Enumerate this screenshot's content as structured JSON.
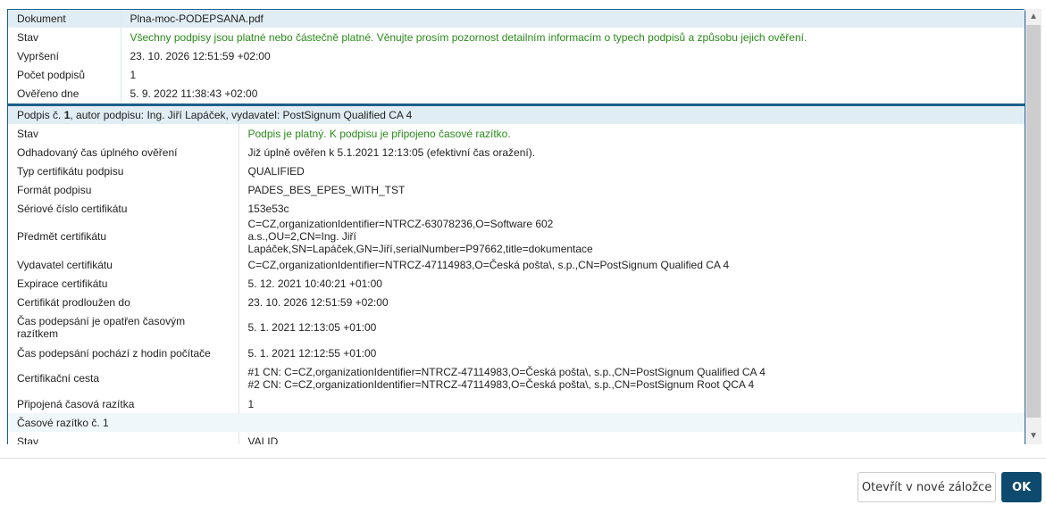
{
  "document": {
    "rows": [
      {
        "label": "Dokument",
        "value": "Plna-moc-PODEPSANA.pdf"
      },
      {
        "label": "Stav",
        "value": "Všechny podpisy jsou platné nebo částečně platné. Věnujte prosím pozornost detailním informacím o typech podpisů a způsobu jejich ověření."
      },
      {
        "label": "Vypršení",
        "value": "23. 10. 2026 12:51:59 +02:00"
      },
      {
        "label": "Počet podpisů",
        "value": "1"
      },
      {
        "label": "Ověřeno dne",
        "value": "5. 9. 2022 11:38:43 +02:00"
      }
    ]
  },
  "signature": {
    "header_prefix": "Podpis č. ",
    "header_number": "1",
    "header_rest": ", autor podpisu: Ing. Jiří Lapáček, vydavatel: PostSignum Qualified CA 4",
    "rows": [
      {
        "label": "Stav",
        "value": "Podpis je platný. K podpisu je připojeno časové razítko."
      },
      {
        "label": "Odhadovaný čas úplného ověření",
        "value": "Již úplně ověřen k 5.1.2021 12:13:05 (efektivní čas oražení)."
      },
      {
        "label": "Typ certifikátu podpisu",
        "value": "QUALIFIED"
      },
      {
        "label": "Formát podpisu",
        "value": "PADES_BES_EPES_WITH_TST"
      },
      {
        "label": "Sériové číslo certifikátu",
        "value": "153e53c"
      },
      {
        "label": "Předmět certifikátu",
        "value": "C=CZ,organizationIdentifier=NTRCZ-63078236,O=Software 602 a.s.,OU=2,CN=Ing. Jiří Lapáček,SN=Lapáček,GN=Jiří,serialNumber=P97662,title=dokumentace"
      },
      {
        "label": "Vydavatel certifikátu",
        "value": "C=CZ,organizationIdentifier=NTRCZ-47114983,O=Česká pošta\\, s.p.,CN=PostSignum Qualified CA 4"
      },
      {
        "label": "Expirace certifikátu",
        "value": "5. 12. 2021 10:40:21 +01:00"
      },
      {
        "label": "Certifikát prodloužen do",
        "value": "23. 10. 2026 12:51:59 +02:00"
      },
      {
        "label": "Čas podepsání je opatřen časovým razítkem",
        "value": "5. 1. 2021 12:13:05 +01:00"
      },
      {
        "label": "Čas podepsání pochází z hodin počítače",
        "value": "5. 1. 2021 12:12:55 +01:00"
      },
      {
        "label": "Certifikační cesta",
        "value": "#1 CN: C=CZ,organizationIdentifier=NTRCZ-47114983,O=Česká pošta\\, s.p.,CN=PostSignum Qualified CA 4",
        "value2": "#2 CN: C=CZ,organizationIdentifier=NTRCZ-47114983,O=Česká pošta\\, s.p.,CN=PostSignum Root QCA 4"
      },
      {
        "label": "Připojená časová razítka",
        "value": "1"
      }
    ],
    "timestamp_header": "Časové razítko č. 1",
    "timestamp_rows": [
      {
        "label": "Stav",
        "value": "VALID"
      }
    ]
  },
  "buttons": {
    "open": "Otevřít v nové záložce",
    "ok": "OK"
  },
  "colors": {
    "accent": "#1a5e8a",
    "valid_text": "#2a8a1a",
    "primary_button": "#0d4a6e"
  }
}
